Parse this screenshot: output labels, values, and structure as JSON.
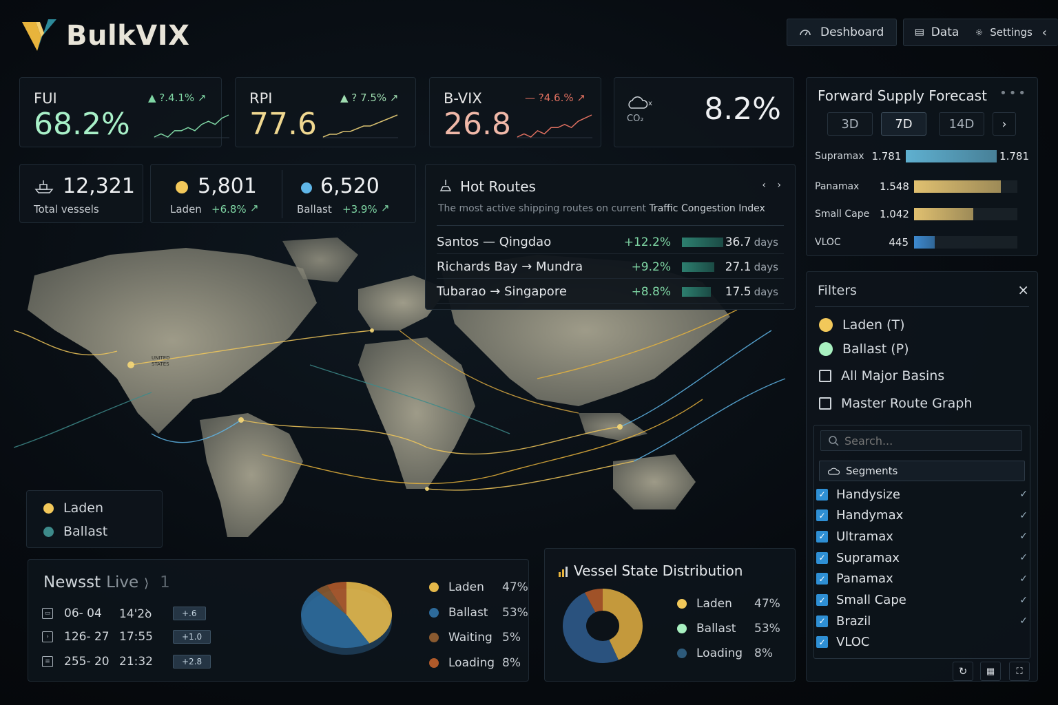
{
  "app": {
    "name": "BulkVIX"
  },
  "nav": {
    "dashboard": "Deshboard",
    "data": "Data",
    "settings": "Settings",
    "collapse": "‹"
  },
  "metrics": [
    {
      "name": "FUI",
      "value": "68.2%",
      "change": "▲ ?.4.1% ↗",
      "color": "#a8f0c8",
      "change_color": "#7fd6a4",
      "spark_color": "#7fd6a4",
      "trend": [
        3,
        4,
        3,
        5,
        5,
        6,
        5,
        7,
        8,
        7,
        9,
        10
      ]
    },
    {
      "name": "RPI",
      "value": "77.6",
      "change": "▲ ? 7.5% ↗",
      "color": "#f0d890",
      "change_color": "#9fdcb0",
      "spark_color": "#d8c070",
      "trend": [
        2,
        3,
        3,
        4,
        4,
        5,
        6,
        6,
        7,
        8,
        9,
        10
      ]
    },
    {
      "name": "B-VIX",
      "value": "26.8",
      "change": "— ?4.6.% ↗",
      "color": "#f0b8a8",
      "change_color": "#e07060",
      "spark_color": "#e07060",
      "trend": [
        3,
        4,
        3,
        5,
        4,
        6,
        6,
        7,
        6,
        8,
        9,
        10
      ]
    }
  ],
  "co2": {
    "label": "CO₂",
    "value": "8.2%"
  },
  "counts": {
    "total": {
      "value": "12,321",
      "label": "Total vessels"
    },
    "laden": {
      "value": "5,801",
      "label": "Laden",
      "change": "+6.8%",
      "arrow": "↗",
      "dot_color": "#f2c85a"
    },
    "ballast": {
      "value": "6,520",
      "label": "Ballast",
      "change": "+3.9%",
      "arrow": "↗",
      "dot_color": "#5fb6e8"
    }
  },
  "hot_routes": {
    "title": "Hot Routes",
    "subtitle_prefix": "The most active shipping routes on current ",
    "subtitle_em": "Traffic Congestion Index",
    "unit": "days",
    "routes": [
      {
        "name": "Santos — Qingdao",
        "change": "+12.2%",
        "level": 1.0,
        "days": "36.7"
      },
      {
        "name": "Richards Bay → Mundra",
        "change": "+9.2%",
        "level": 0.78,
        "days": "27.1"
      },
      {
        "name": "Tubarao → Singapore",
        "change": "+8.8%",
        "level": 0.7,
        "days": "17.5"
      }
    ]
  },
  "forecast": {
    "title": "Forward Supply Forecast",
    "tabs": [
      "3D",
      "7D",
      "14D"
    ],
    "active_tab": "7D",
    "rows": [
      {
        "name": "Supramax",
        "value": "1.781",
        "end_label": "1.781",
        "level": 1.0,
        "color": "#5fb0d0"
      },
      {
        "name": "Panamax",
        "value": "1.548",
        "end_label": "",
        "level": 0.84,
        "color": "#e0c070"
      },
      {
        "name": "Small Cape",
        "value": "1.042",
        "end_label": "",
        "level": 0.57,
        "color": "#e0c070"
      },
      {
        "name": "VLOC",
        "value": "445",
        "end_label": "",
        "level": 0.2,
        "color": "#3d8ad0"
      }
    ]
  },
  "filters": {
    "title": "Filters",
    "close": "×",
    "toggles": [
      {
        "label": "Laden (T)",
        "color": "#f2c85a"
      },
      {
        "label": "Ballast (P)",
        "color": "#a8f0c0"
      }
    ],
    "checkboxes": [
      "All Major Basins",
      "Master Route Graph"
    ],
    "search_placeholder": "Search...",
    "segments_label": "Segments",
    "segments": [
      "Handysize",
      "Handymax",
      "Ultramax",
      "Supramax",
      "Panamax",
      "Small Cape",
      "Brazil",
      "VLOC"
    ],
    "segment_ticks": [
      true,
      true,
      true,
      true,
      true,
      true,
      true,
      false
    ]
  },
  "map_legend": [
    {
      "label": "Laden",
      "color": "#f2c85a"
    },
    {
      "label": "Ballast",
      "color": "#3d8a8a"
    }
  ],
  "map_text": {
    "usa": "UNITED STATES"
  },
  "news": {
    "title": "Newsst",
    "live": "Live",
    "live_arrow": "⟩",
    "count": "1",
    "rows": [
      {
        "date": "06- 04",
        "time": "14'2ꝺ",
        "badge": "+.6"
      },
      {
        "date": "126- 27",
        "time": "17:55",
        "badge": "+1.0"
      },
      {
        "date": "255- 20",
        "time": "21:32",
        "badge": "+2.8"
      }
    ]
  },
  "pie_chart": {
    "chart_data": {
      "type": "pie",
      "slices": [
        {
          "name": "Laden",
          "pct": "47%",
          "value": 47,
          "color": "#e4b84a"
        },
        {
          "name": "Ballast",
          "pct": "53%",
          "value": 53,
          "color": "#2d6a9a"
        },
        {
          "name": "Waiting",
          "pct": "5%",
          "value": 5,
          "color": "#8a5a30"
        },
        {
          "name": "Loading",
          "pct": "8%",
          "value": 8,
          "color": "#b05a2a"
        }
      ]
    }
  },
  "vessel_state": {
    "title": "Vessel State Distribution",
    "chart_data": {
      "type": "pie",
      "slices": [
        {
          "name": "Laden",
          "pct": "47%",
          "value": 47,
          "color": "#d8a840"
        },
        {
          "name": "Ballast",
          "pct": "53%",
          "value": 53,
          "color": "#2d5a8a"
        },
        {
          "name": "Loading",
          "pct": "8%",
          "value": 8,
          "color": "#b05a2a"
        }
      ]
    },
    "legend_colors": [
      "#f2c85a",
      "#a8f0c0",
      "#2d5a7a"
    ]
  }
}
